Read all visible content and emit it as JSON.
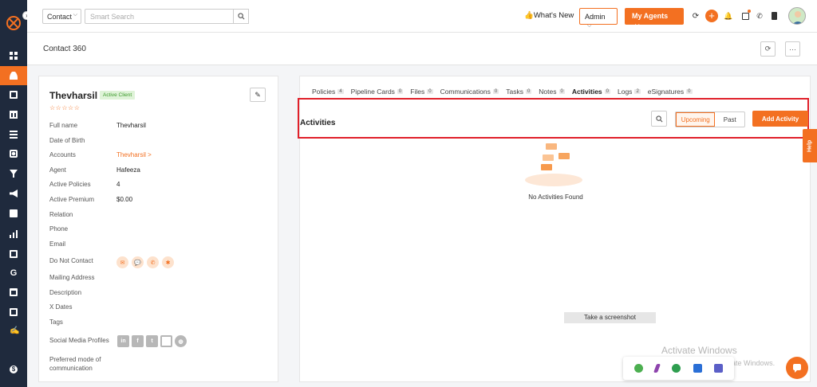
{
  "header": {
    "search_type": "Contact",
    "search_placeholder": "Smart Search",
    "whats_new": "What's New",
    "role": "Admin",
    "agents_button": "My Agents"
  },
  "page": {
    "title": "Contact 360"
  },
  "contact": {
    "name": "Thevharsil",
    "status_badge": "Active Client",
    "stars": "☆☆☆☆☆",
    "fields": [
      {
        "label": "Full name",
        "value": "Thevharsil"
      },
      {
        "label": "Date of Birth",
        "value": ""
      },
      {
        "label": "Accounts",
        "value": "Thevharsil >"
      },
      {
        "label": "Agent",
        "value": "Hafeeza"
      },
      {
        "label": "Active Policies",
        "value": "4"
      },
      {
        "label": "Active Premium",
        "value": "$0.00"
      },
      {
        "label": "Relation",
        "value": ""
      },
      {
        "label": "Phone",
        "value": ""
      },
      {
        "label": "Email",
        "value": ""
      },
      {
        "label": "Do Not Contact",
        "value": ""
      },
      {
        "label": "Mailing Address",
        "value": ""
      },
      {
        "label": "Description",
        "value": ""
      },
      {
        "label": "X Dates",
        "value": ""
      },
      {
        "label": "Tags",
        "value": ""
      },
      {
        "label": "Social Media Profiles",
        "value": ""
      },
      {
        "label": "Preferred mode of",
        "value": ""
      },
      {
        "label": "communication",
        "value": ""
      }
    ]
  },
  "tabs": [
    {
      "label": "Policies",
      "count": "4"
    },
    {
      "label": "Pipeline Cards",
      "count": "0"
    },
    {
      "label": "Files",
      "count": "0"
    },
    {
      "label": "Communications",
      "count": "0"
    },
    {
      "label": "Tasks",
      "count": "0"
    },
    {
      "label": "Notes",
      "count": "0"
    },
    {
      "label": "Activities",
      "count": "0"
    },
    {
      "label": "Logs",
      "count": "2"
    },
    {
      "label": "eSignatures",
      "count": "0"
    }
  ],
  "activities": {
    "title": "Activities",
    "toggle_upcoming": "Upcoming",
    "toggle_past": "Past",
    "add_button": "Add Activity",
    "empty_message": "No Activities Found"
  },
  "overlay": {
    "screenshot_tip": "Take a screenshot",
    "watermark_title": "Activate Windows",
    "watermark_sub": "Go to Settings to activate Windows.",
    "help_tab": "Help"
  },
  "colors": {
    "brand": "#f37021",
    "sidebar": "#1f2a3d",
    "highlight": "#e0202a"
  }
}
